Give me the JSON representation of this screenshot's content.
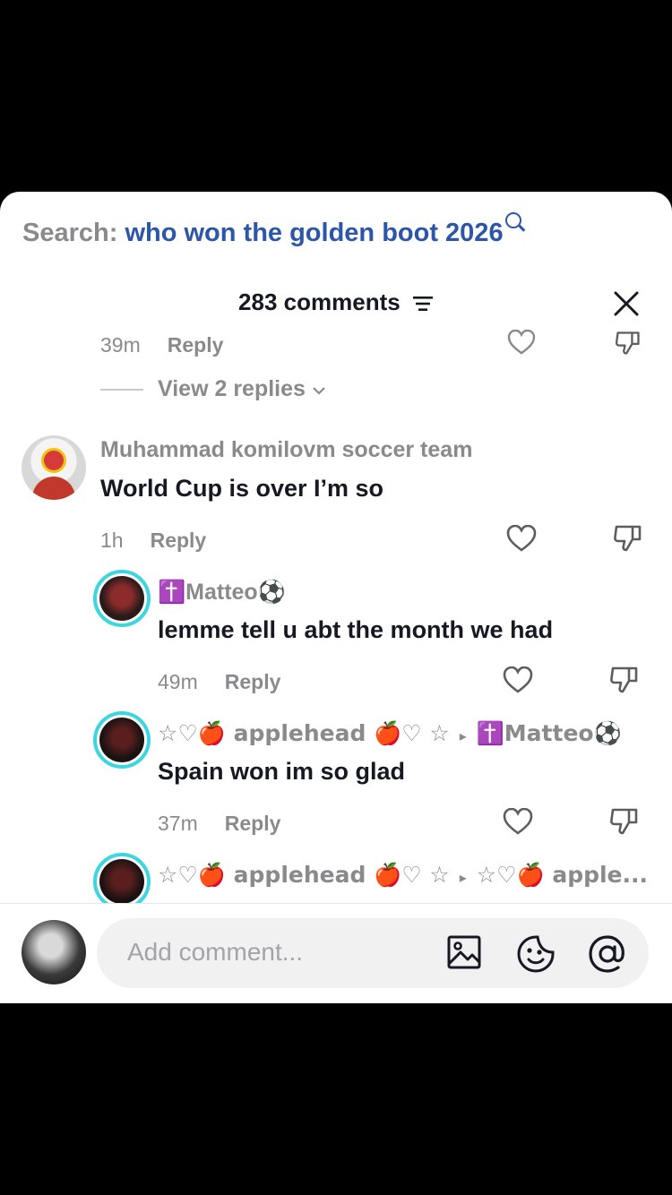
{
  "search": {
    "label": "Search:",
    "query": "who won the golden boot 2026"
  },
  "header": {
    "comment_count": "283 comments"
  },
  "comments": [
    {
      "time": "39m",
      "reply": "Reply",
      "view_replies": "View 2 replies"
    },
    {
      "name": "Muhammad komilovm soccer team",
      "text": "World Cup is over I’m so",
      "time": "1h",
      "reply": "Reply"
    },
    {
      "name": "Matteo",
      "name_prefix": "✝️",
      "name_suffix": "⚽",
      "text": "lemme tell u abt the month we had",
      "time": "49m",
      "reply": "Reply"
    },
    {
      "name": "☆♡🍎 applehead 🍎♡ ☆",
      "reply_to": "✝️Matteo⚽",
      "text": "Spain won im so glad",
      "time": "37m",
      "reply": "Reply"
    },
    {
      "name": "☆♡🍎 applehead 🍎♡ ☆",
      "reply_to": "☆♡🍎 apple..."
    }
  ],
  "footer": {
    "placeholder": "Add comment..."
  },
  "colors": {
    "accent_query": "#2c56a8",
    "ring": "#3cd6e0",
    "muted": "#8a8a8e"
  }
}
